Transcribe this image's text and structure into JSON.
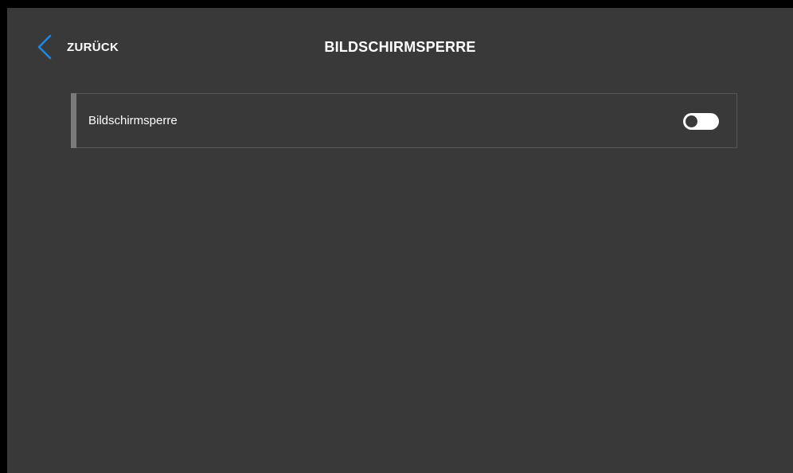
{
  "header": {
    "back_label": "ZURÜCK",
    "title": "BILDSCHIRMSPERRE"
  },
  "settings": [
    {
      "label": "Bildschirmsperre",
      "toggle_on": false
    }
  ],
  "icons": {
    "back": "chevron-left-icon"
  },
  "colors": {
    "background": "#393939",
    "accent_blue": "#1e88e5",
    "row_border": "#565656",
    "row_accent": "#7a7a7a",
    "text": "#ffffff",
    "bezel": "#000000"
  }
}
